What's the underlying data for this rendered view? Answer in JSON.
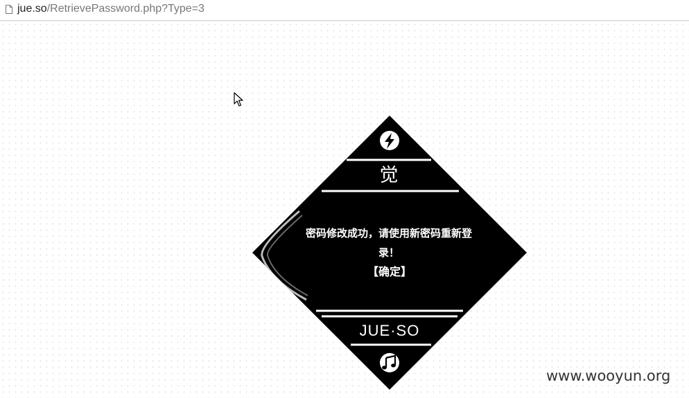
{
  "browser": {
    "url_host": "jue.so",
    "url_path": "/RetrievePassword.php?Type=3",
    "page_icon": "document-icon"
  },
  "card": {
    "logo_char": "觉",
    "message": "密码修改成功，请使用新密码重新登录！",
    "confirm_label": "【确定】",
    "brand": "JUE·SO",
    "top_icon": "lightning-icon",
    "bottom_icon": "music-note-icon",
    "background_color": "#000000",
    "foreground_color": "#ffffff"
  },
  "watermark": "www.wooyun.org"
}
